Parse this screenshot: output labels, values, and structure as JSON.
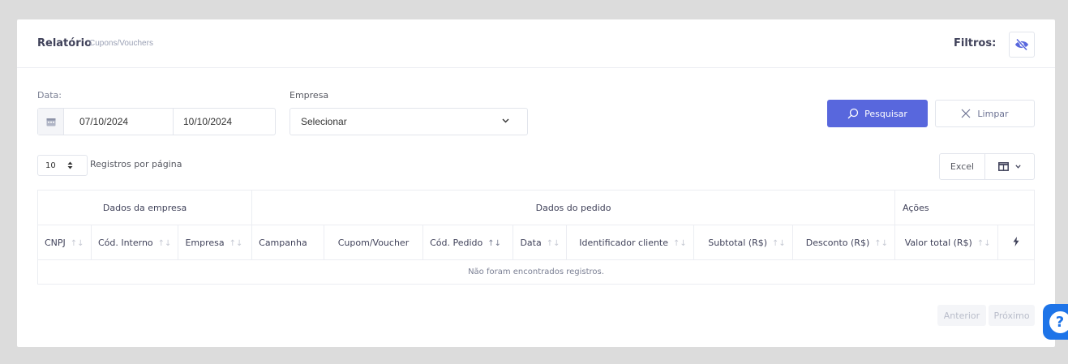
{
  "header": {
    "title": "Relatório",
    "subtitle": "Cupons/Vouchers",
    "filters_label": "Filtros:"
  },
  "icons": {
    "filters_toggle": "eye-slash-icon",
    "calendar": "calendar-icon",
    "search": "search-icon",
    "clear": "close-icon",
    "columns": "columns-icon",
    "flash": "bolt-icon",
    "help": "question-icon"
  },
  "filters": {
    "date_label": "Data:",
    "date_from": "07/10/2024",
    "date_to": "10/10/2024",
    "company_label": "Empresa",
    "company_value": "Selecionar",
    "search_label": "Pesquisar",
    "clear_label": "Limpar"
  },
  "toolbar": {
    "per_page": "10",
    "per_page_label": "Registros por página",
    "excel_label": "Excel"
  },
  "table": {
    "groups": [
      "Dados da empresa",
      "Dados do pedido",
      "Ações"
    ],
    "columns": [
      "CNPJ",
      "Cód. Interno",
      "Empresa",
      "Campanha",
      "Cupom/Voucher",
      "Cód. Pedido",
      "Data",
      "Identificador cliente",
      "Subtotal (R$)",
      "Desconto (R$)",
      "Valor total (R$)"
    ],
    "empty_message": "Não foram encontrados registros."
  },
  "pagination": {
    "prev_label": "Anterior",
    "next_label": "Próximo"
  },
  "colors": {
    "accent": "#5867dd",
    "help": "#1e74e8"
  }
}
